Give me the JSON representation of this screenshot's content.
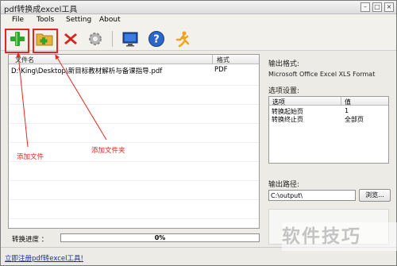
{
  "window": {
    "title": "pdf转换成excel工具"
  },
  "menu": [
    "File",
    "Tools",
    "Setting",
    "About"
  ],
  "toolbar": {
    "buttons": [
      {
        "name": "add-file",
        "icon": "plus-icon"
      },
      {
        "name": "add-folder",
        "icon": "folder-add-icon"
      },
      {
        "name": "remove",
        "icon": "red-x-icon"
      },
      {
        "name": "settings",
        "icon": "gear-icon"
      },
      {
        "name": "monitor",
        "icon": "monitor-icon"
      },
      {
        "name": "help",
        "icon": "help-icon"
      },
      {
        "name": "run",
        "icon": "running-man-icon"
      }
    ]
  },
  "filelist": {
    "col_name": "文件名",
    "col_format": "格式",
    "rows": [
      {
        "name": "D:\\King\\Desktop\\新目标教材解析与备课指导.pdf",
        "format": "PDF"
      }
    ]
  },
  "annotations": {
    "add_file": "添加文件",
    "add_folder": "添加文件夹"
  },
  "progress": {
    "label": "转换进度 ：",
    "value_text": "0%",
    "value": 0
  },
  "register_link": "立即注册pdf转excel工具!",
  "right": {
    "output_format_label": "输出格式:",
    "output_format_value": "Microsoft Office Excel XLS Format",
    "options_label": "选项设置:",
    "options_col_option": "选项",
    "options_col_value": "值",
    "options_rows": [
      {
        "option": "转换起始页",
        "value": "1"
      },
      {
        "option": "转换终止页",
        "value": "全部页"
      }
    ],
    "output_path_label": "输出路径:",
    "output_path_value": "C:\\output\\",
    "browse_label": "浏览..."
  },
  "watermark": "软件技巧",
  "colors": {
    "annotation": "#e5261f",
    "link": "#1a2ea8"
  }
}
